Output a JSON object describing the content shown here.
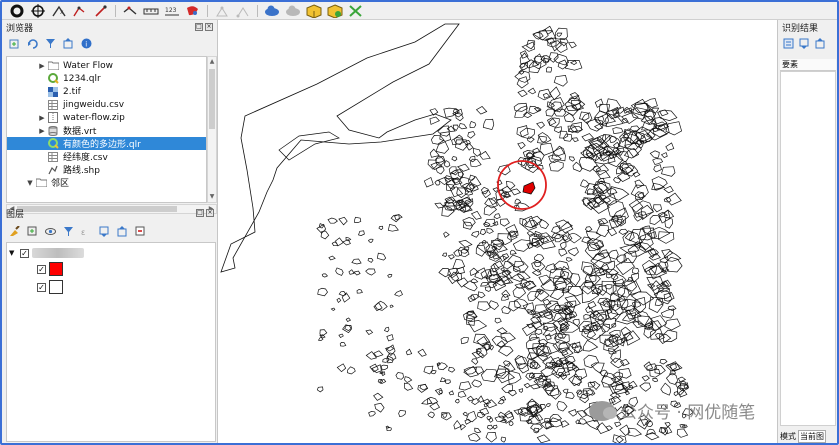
{
  "toolbar": {
    "icons": [
      "select-circle-icon",
      "pan-crosshair-icon",
      "zoom-x-icon",
      "edit-node-icon",
      "add-point-icon",
      "vertex-tool-icon",
      "ruler-icon",
      "measure-123-icon",
      "style-icon",
      "digitize-icon",
      "digitize-2-icon",
      "cloud-icon",
      "cloud-2-icon",
      "package-icon",
      "package-2-icon",
      "tools-icon"
    ]
  },
  "browser_panel": {
    "title": "浏览器",
    "items": [
      {
        "label": "Water Flow",
        "icon": "folder-icon",
        "expander": true,
        "selected": false
      },
      {
        "label": "1234.qlr",
        "icon": "qgis-layer-icon",
        "expander": false,
        "selected": false
      },
      {
        "label": "2.tif",
        "icon": "raster-icon",
        "expander": false,
        "selected": false
      },
      {
        "label": "jingweidu.csv",
        "icon": "table-icon",
        "expander": false,
        "selected": false
      },
      {
        "label": "water-flow.zip",
        "icon": "zip-icon",
        "expander": true,
        "selected": false
      },
      {
        "label": "数据.vrt",
        "icon": "vrt-icon",
        "expander": true,
        "selected": false
      },
      {
        "label": "有颜色的多边形.qlr",
        "icon": "qgis-layer-icon",
        "expander": false,
        "selected": true
      },
      {
        "label": "经纬度.csv",
        "icon": "table-icon",
        "expander": false,
        "selected": false
      },
      {
        "label": "路线.shp",
        "icon": "shapefile-icon",
        "expander": false,
        "selected": false
      },
      {
        "label": "邻区",
        "icon": "folder-icon",
        "expander": true,
        "selected": false
      }
    ]
  },
  "layers_panel": {
    "title": "图层",
    "symbols": [
      {
        "color": "#ff0000",
        "checked": true
      },
      {
        "color": "#ffffff",
        "checked": true
      }
    ]
  },
  "right_panel": {
    "title": "识别结果",
    "feature_header": "要素",
    "footer_mode": "模式",
    "footer_current": "当前图"
  },
  "watermark": {
    "text": "公众号 · 网优随笔"
  },
  "colors": {
    "selection": "#2f88d8",
    "highlight_circle": "#e02020",
    "selected_polygon": "#e00000",
    "frame": "#3b6fd6"
  }
}
